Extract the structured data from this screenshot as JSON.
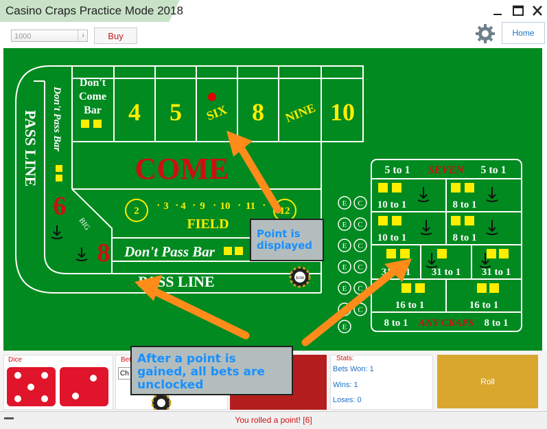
{
  "window": {
    "title": "Casino Craps Practice Mode 2018",
    "controls": [
      "minimize",
      "maximize",
      "close"
    ]
  },
  "toolbar": {
    "amount_value": "1000",
    "spinner_glyph": "↓",
    "buy_label": "Buy",
    "home_label": "Home"
  },
  "table": {
    "dont_come_bar": [
      "Don't",
      "Come",
      "Bar"
    ],
    "place_numbers": [
      "4",
      "5",
      "SIX",
      "8",
      "NINE",
      "10"
    ],
    "point_number": "SIX",
    "come_label": "COME",
    "field_label": "FIELD",
    "field_numbers": [
      "2",
      "3",
      "4",
      "9",
      "10",
      "11",
      "12"
    ],
    "dont_pass_bar_label": "Don't Pass Bar",
    "dont_pass_bar_vertical": "Don't Pass Bar",
    "pass_line_label": "PASS LINE",
    "big_6": "6",
    "big_8": "8",
    "big_label": "BIG",
    "chip_value": "$100",
    "ce_labels": [
      "E",
      "C"
    ],
    "props": {
      "seven_left": "5 to 1",
      "seven_label": "SEVEN",
      "seven_right": "5 to 1",
      "hard_odds": [
        "10 to 1",
        "8 to 1",
        "10 to 1",
        "8 to 1"
      ],
      "row3_odds": [
        "31 to 1",
        "31 to 1",
        "31 to 1"
      ],
      "row4_odds": [
        "16 to 1",
        "16 to 1"
      ],
      "craps_left": "8 to 1",
      "craps_label": "ANY CRAPS",
      "craps_right": "8 to 1"
    }
  },
  "callouts": {
    "point": "Point is displayed",
    "unlocked": "After a point is gained, all bets are unclocked"
  },
  "bottom": {
    "dice_label": "Dice",
    "dice_values": [
      5,
      2
    ],
    "bet_label": "Bet",
    "bet_select_value": "Ch",
    "stats_label": "Stats:",
    "bets_won": "Bets Won: 1",
    "wins": "Wins: 1",
    "losses": "Loses: 0",
    "roll_label": "Roll"
  },
  "status": {
    "message": "You rolled a point! [6]"
  },
  "colors": {
    "felt": "#008a1f",
    "accent_red": "#d01010",
    "yellow": "#ffee00",
    "roll_button": "#d9a62e",
    "red_panel": "#b41e1e",
    "callout_text": "#1890ff",
    "arrow": "#ff8c1a"
  }
}
